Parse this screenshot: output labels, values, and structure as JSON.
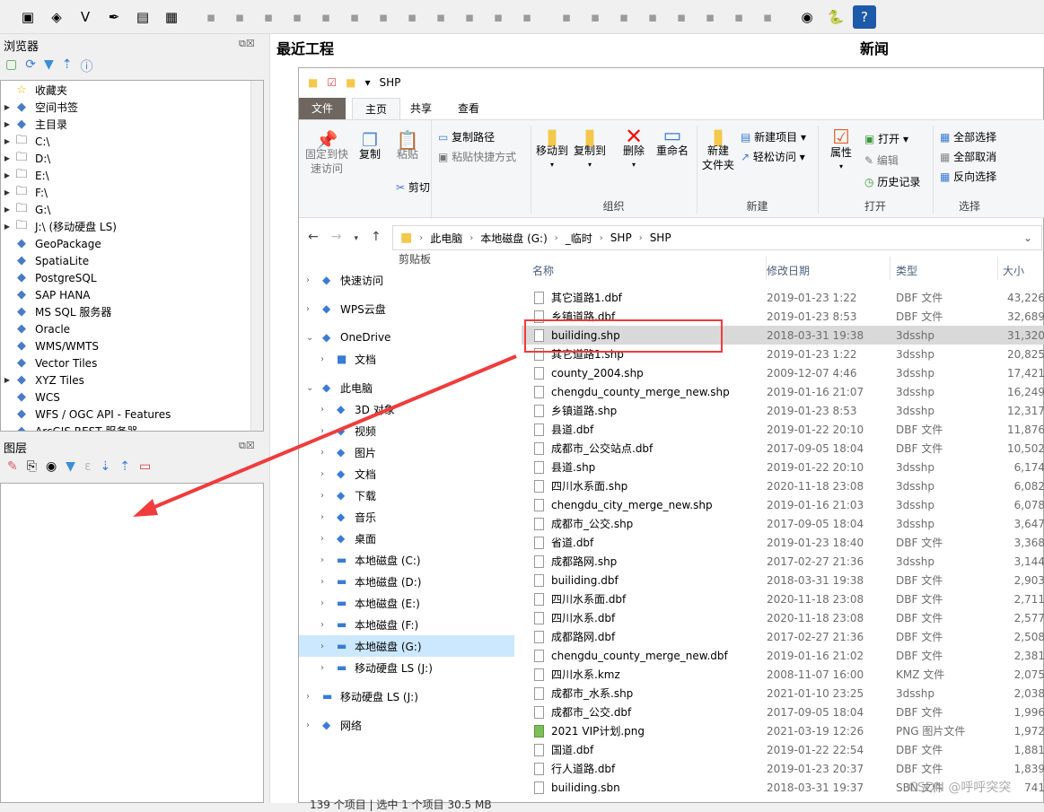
{
  "qgis": {
    "toolbar_icons": [
      "open-project-icon",
      "new-geopackage-icon",
      "new-shapefile-icon",
      "new-spatialite-icon",
      "new-temporary-layer-icon",
      "new-virtual-layer-icon",
      "digitize-icon",
      "edit-pencil-icon",
      "save-edits-icon",
      "add-feature-icon",
      "vertex-tool-icon",
      "attribute-table-icon",
      "delete-icon",
      "cut-icon",
      "copy-icon",
      "paste-icon",
      "undo-icon",
      "redo-icon",
      "label-icon",
      "label-pin-icon",
      "label-abc-icon",
      "label-abc-red-icon",
      "label-show-icon",
      "label-move-icon",
      "label-rotate-icon",
      "label-change-icon",
      "globe-plugin-icon",
      "python-icon",
      "help-icon"
    ],
    "browser": {
      "title": "浏览器",
      "items": [
        {
          "label": "收藏夹",
          "icon": "star-icon",
          "expand": false
        },
        {
          "label": "空间书签",
          "icon": "bookmark-icon",
          "expand": true
        },
        {
          "label": "主目录",
          "icon": "home-folder-icon",
          "expand": true
        },
        {
          "label": "C:\\",
          "icon": "folder-icon",
          "expand": true
        },
        {
          "label": "D:\\",
          "icon": "folder-icon",
          "expand": true
        },
        {
          "label": "E:\\",
          "icon": "folder-icon",
          "expand": true
        },
        {
          "label": "F:\\",
          "icon": "folder-icon",
          "expand": true
        },
        {
          "label": "G:\\",
          "icon": "folder-icon",
          "expand": true
        },
        {
          "label": "J:\\ (移动硬盘 LS)",
          "icon": "folder-icon",
          "expand": true
        },
        {
          "label": "GeoPackage",
          "icon": "geopackage-icon",
          "expand": false
        },
        {
          "label": "SpatiaLite",
          "icon": "feather-icon",
          "expand": false
        },
        {
          "label": "PostgreSQL",
          "icon": "elephant-icon",
          "expand": false
        },
        {
          "label": "SAP HANA",
          "icon": "hana-icon",
          "expand": false
        },
        {
          "label": "MS SQL 服务器",
          "icon": "mssql-icon",
          "expand": false
        },
        {
          "label": "Oracle",
          "icon": "oracle-icon",
          "expand": false
        },
        {
          "label": "WMS/WMTS",
          "icon": "globe-icon",
          "expand": false
        },
        {
          "label": "Vector Tiles",
          "icon": "grid-icon",
          "expand": false
        },
        {
          "label": "XYZ Tiles",
          "icon": "tiles-icon",
          "expand": true
        },
        {
          "label": "WCS",
          "icon": "globe-icon",
          "expand": false
        },
        {
          "label": "WFS / OGC API - Features",
          "icon": "globe-icon",
          "expand": false
        },
        {
          "label": "ArcGIS REST 服务器",
          "icon": "globe-icon",
          "expand": false
        }
      ]
    },
    "layers": {
      "title": "图层"
    },
    "recent_projects": "最近工程",
    "news": "新闻"
  },
  "explorer": {
    "title": "SHP",
    "tabs": [
      "文件",
      "主页",
      "共享",
      "查看"
    ],
    "ribbon": {
      "pin": "固定到快\n速访问",
      "copy": "复制",
      "paste": "粘贴",
      "copy_path": "复制路径",
      "paste_shortcut": "粘贴快捷方式",
      "cut": "剪切",
      "group_clipboard": "剪贴板",
      "move_to": "移动到",
      "copy_to": "复制到",
      "delete": "删除",
      "rename": "重命名",
      "group_organize": "组织",
      "new_folder": "新建\n文件夹",
      "new_item": "新建项目",
      "easy_access": "轻松访问",
      "group_new": "新建",
      "properties": "属性",
      "open": "打开",
      "edit": "编辑",
      "history": "历史记录",
      "group_open": "打开",
      "select_all": "全部选择",
      "select_none": "全部取消",
      "invert": "反向选择",
      "group_select": "选择"
    },
    "breadcrumb": [
      "此电脑",
      "本地磁盘 (G:)",
      "_临时",
      "SHP",
      "SHP"
    ],
    "nav": [
      {
        "label": "快速访问",
        "icon": "star-blue-icon",
        "indent": 0
      },
      {
        "label": "WPS云盘",
        "icon": "cloud-icon",
        "indent": 0
      },
      {
        "label": "OneDrive",
        "icon": "onedrive-icon",
        "indent": 0,
        "expanded": true
      },
      {
        "label": "文档",
        "icon": "folder-icon",
        "indent": 1
      },
      {
        "label": "此电脑",
        "icon": "pc-icon",
        "indent": 0,
        "expanded": true
      },
      {
        "label": "3D 对象",
        "icon": "cube-icon",
        "indent": 1
      },
      {
        "label": "视频",
        "icon": "video-icon",
        "indent": 1
      },
      {
        "label": "图片",
        "icon": "picture-icon",
        "indent": 1
      },
      {
        "label": "文档",
        "icon": "document-icon",
        "indent": 1
      },
      {
        "label": "下载",
        "icon": "download-icon",
        "indent": 1
      },
      {
        "label": "音乐",
        "icon": "music-icon",
        "indent": 1
      },
      {
        "label": "桌面",
        "icon": "desktop-icon",
        "indent": 1
      },
      {
        "label": "本地磁盘 (C:)",
        "icon": "drive-icon",
        "indent": 1
      },
      {
        "label": "本地磁盘 (D:)",
        "icon": "drive-icon",
        "indent": 1
      },
      {
        "label": "本地磁盘 (E:)",
        "icon": "drive-icon",
        "indent": 1
      },
      {
        "label": "本地磁盘 (F:)",
        "icon": "drive-icon",
        "indent": 1
      },
      {
        "label": "本地磁盘 (G:)",
        "icon": "drive-icon",
        "indent": 1,
        "selected": true
      },
      {
        "label": "移动硬盘 LS (J:)",
        "icon": "drive-icon",
        "indent": 1
      },
      {
        "label": "移动硬盘 LS (J:)",
        "icon": "drive-icon",
        "indent": 0
      },
      {
        "label": "网络",
        "icon": "network-icon",
        "indent": 0
      }
    ],
    "columns": [
      "名称",
      "修改日期",
      "类型",
      "大小"
    ],
    "files": [
      [
        "其它道路1.dbf",
        "2019-01-23 1:22",
        "DBF 文件",
        "43,226"
      ],
      [
        "乡镇道路.dbf",
        "2019-01-23 8:53",
        "DBF 文件",
        "32,689"
      ],
      [
        "builiding.shp",
        "2018-03-31 19:38",
        "3dsshp",
        "31,320"
      ],
      [
        "其它道路1.shp",
        "2019-01-23 1:22",
        "3dsshp",
        "20,825"
      ],
      [
        "county_2004.shp",
        "2009-12-07 4:46",
        "3dsshp",
        "17,421"
      ],
      [
        "chengdu_county_merge_new.shp",
        "2019-01-16 21:07",
        "3dsshp",
        "16,249"
      ],
      [
        "乡镇道路.shp",
        "2019-01-23 8:53",
        "3dsshp",
        "12,317"
      ],
      [
        "县道.dbf",
        "2019-01-22 20:10",
        "DBF 文件",
        "11,876"
      ],
      [
        "成都市_公交站点.dbf",
        "2017-09-05 18:04",
        "DBF 文件",
        "10,502"
      ],
      [
        "县道.shp",
        "2019-01-22 20:10",
        "3dsshp",
        "6,174"
      ],
      [
        "四川水系面.shp",
        "2020-11-18 23:08",
        "3dsshp",
        "6,082"
      ],
      [
        "chengdu_city_merge_new.shp",
        "2019-01-16 21:03",
        "3dsshp",
        "6,078"
      ],
      [
        "成都市_公交.shp",
        "2017-09-05 18:04",
        "3dsshp",
        "3,647"
      ],
      [
        "省道.dbf",
        "2019-01-23 18:40",
        "DBF 文件",
        "3,368"
      ],
      [
        "成都路网.shp",
        "2017-02-27 21:36",
        "3dsshp",
        "3,144"
      ],
      [
        "builiding.dbf",
        "2018-03-31 19:38",
        "DBF 文件",
        "2,903"
      ],
      [
        "四川水系面.dbf",
        "2020-11-18 23:08",
        "DBF 文件",
        "2,711"
      ],
      [
        "四川水系.dbf",
        "2020-11-18 23:08",
        "DBF 文件",
        "2,577"
      ],
      [
        "成都路网.dbf",
        "2017-02-27 21:36",
        "DBF 文件",
        "2,508"
      ],
      [
        "chengdu_county_merge_new.dbf",
        "2019-01-16 21:02",
        "DBF 文件",
        "2,381"
      ],
      [
        "四川水系.kmz",
        "2008-11-07 16:00",
        "KMZ 文件",
        "2,075"
      ],
      [
        "成都市_水系.shp",
        "2021-01-10 23:25",
        "3dsshp",
        "2,038"
      ],
      [
        "成都市_公交.dbf",
        "2017-09-05 18:04",
        "DBF 文件",
        "1,996"
      ],
      [
        "2021 VIP计划.png",
        "2021-03-19 12:26",
        "PNG 图片文件",
        "1,972"
      ],
      [
        "国道.dbf",
        "2019-01-22 22:54",
        "DBF 文件",
        "1,881"
      ],
      [
        "行人道路.dbf",
        "2019-01-23 20:37",
        "DBF 文件",
        "1,839"
      ],
      [
        "builiding.sbn",
        "2018-03-31 19:37",
        "SBN 文件",
        "741"
      ]
    ],
    "selected_file": "builiding.shp",
    "status": "139 个项目 | 选中 1 个项目 30.5 MB"
  },
  "watermark": "CSDN @呼呼突突",
  "colors": {
    "highlight": "#f03c3c",
    "selected_row": "#d9d9d9",
    "nav_selected": "#cce8ff",
    "file_tab": "#6f6660"
  }
}
